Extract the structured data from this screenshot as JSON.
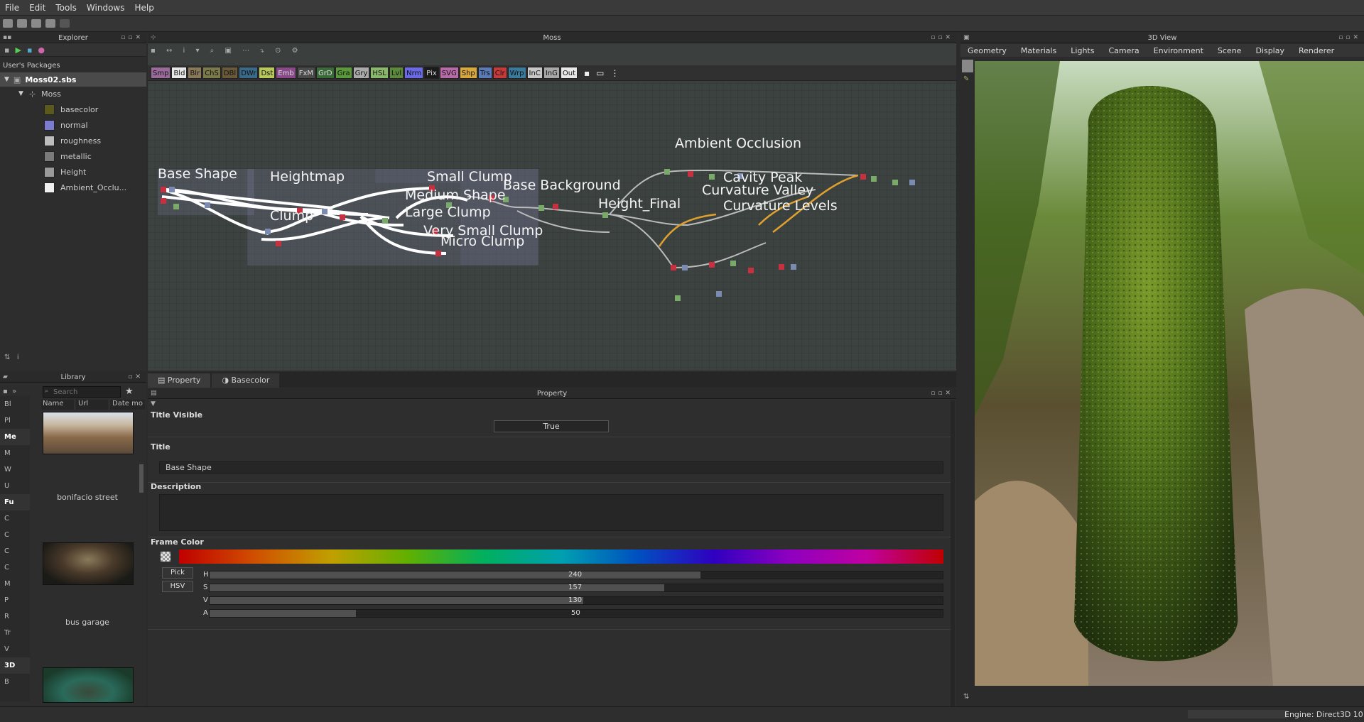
{
  "menu": [
    "File",
    "Edit",
    "Tools",
    "Windows",
    "Help"
  ],
  "explorer": {
    "title": "Explorer",
    "root": "User's Packages",
    "package": "Moss02.sbs",
    "graph": "Moss",
    "outputs": [
      {
        "label": "basecolor",
        "color": "#5a5a1e"
      },
      {
        "label": "normal",
        "color": "#7b7bd0"
      },
      {
        "label": "roughness",
        "color": "#bdbdbd"
      },
      {
        "label": "metallic",
        "color": "#7a7a7a"
      },
      {
        "label": "Height",
        "color": "#9a9a9a"
      },
      {
        "label": "Ambient_Occlu...",
        "color": "#f0f0f0"
      }
    ]
  },
  "library": {
    "title": "Library",
    "search_placeholder": "Search",
    "columns": [
      "Name",
      "Url",
      "Date mo"
    ],
    "categories_left": [
      "Bl",
      "Pl",
      "Me",
      "M",
      "W",
      "U",
      "Fu",
      "C",
      "C",
      "C",
      "C",
      "M",
      "P",
      "R",
      "Tr",
      "V",
      "3D",
      "B"
    ],
    "items": [
      {
        "label": "bonifacio street"
      },
      {
        "label": "bus garage"
      }
    ]
  },
  "graph": {
    "title": "Moss",
    "node_buttons": [
      {
        "label": "Smp",
        "color": "#9a6a9a"
      },
      {
        "label": "Bld",
        "color": "#e8e8e8"
      },
      {
        "label": "Blr",
        "color": "#8a7a5a"
      },
      {
        "label": "ChS",
        "color": "#7a7a4a"
      },
      {
        "label": "DBl",
        "color": "#6a5a3a"
      },
      {
        "label": "DWr",
        "color": "#3a6a8a"
      },
      {
        "label": "Dst",
        "color": "#b8c85a"
      },
      {
        "label": "Emb",
        "color": "#8a4a8a"
      },
      {
        "label": "FxM",
        "color": "#4a4a4a"
      },
      {
        "label": "GrD",
        "color": "#3a6a3a"
      },
      {
        "label": "Gra",
        "color": "#5a9a3a"
      },
      {
        "label": "Gry",
        "color": "#aaaaaa"
      },
      {
        "label": "HSL",
        "color": "#8ab86a"
      },
      {
        "label": "Lvl",
        "color": "#5a8a3a"
      },
      {
        "label": "Nrm",
        "color": "#6a6ae8"
      },
      {
        "label": "Pix",
        "color": "#1a1a1a"
      },
      {
        "label": "SVG",
        "color": "#b86aa8"
      },
      {
        "label": "Shp",
        "color": "#d8a83a"
      },
      {
        "label": "Trs",
        "color": "#5a7ab8"
      },
      {
        "label": "Clr",
        "color": "#c83a3a"
      },
      {
        "label": "Wrp",
        "color": "#3a7a9a"
      },
      {
        "label": "InC",
        "color": "#c8c8c8"
      },
      {
        "label": "InG",
        "color": "#a8a8a8"
      },
      {
        "label": "Out",
        "color": "#e8e8e8"
      }
    ],
    "frames": [
      {
        "label": "Base Shape"
      },
      {
        "label": "Heightmap"
      },
      {
        "label": "Small Clump"
      },
      {
        "label": "Base Background"
      },
      {
        "label": "Medium Shape"
      },
      {
        "label": "Clump"
      },
      {
        "label": "Large Clump"
      },
      {
        "label": "Very Small Clump"
      },
      {
        "label": "Micro Clump"
      },
      {
        "label": "Height_Final"
      },
      {
        "label": "Ambient Occlusion"
      },
      {
        "label": "Cavity Peak"
      },
      {
        "label": "Curvature Valley"
      },
      {
        "label": "Curvature Levels"
      }
    ]
  },
  "property": {
    "tabs": [
      "Property",
      "Basecolor"
    ],
    "title": "Property",
    "title_visible_label": "Title Visible",
    "title_visible_value": "True",
    "title_label": "Title",
    "title_value": "Base Shape",
    "description_label": "Description",
    "description_value": "",
    "frame_color_label": "Frame Color",
    "pick_label": "Pick",
    "mode_label": "HSV",
    "channels": [
      {
        "name": "H",
        "value": "240",
        "fraction": 0.67
      },
      {
        "name": "S",
        "value": "157",
        "fraction": 0.62
      },
      {
        "name": "V",
        "value": "130",
        "fraction": 0.51
      },
      {
        "name": "A",
        "value": "50",
        "fraction": 0.2
      }
    ]
  },
  "view3d": {
    "title": "3D View",
    "menu": [
      "Geometry",
      "Materials",
      "Lights",
      "Camera",
      "Environment",
      "Scene",
      "Display",
      "Renderer"
    ]
  },
  "status": {
    "engine": "Engine: Direct3D 10"
  }
}
